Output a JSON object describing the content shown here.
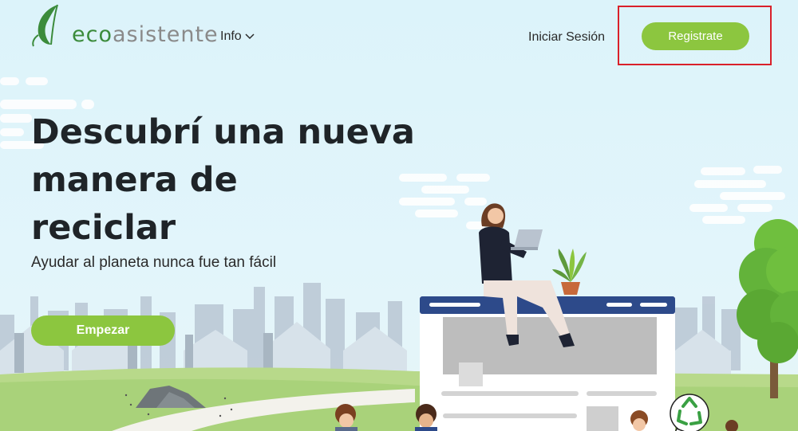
{
  "brand": {
    "logo_eco": "eco",
    "logo_rest": "asistente",
    "accent_color": "#8cc63f",
    "logo_green": "#3b8b3b",
    "highlight_color": "#d9202a"
  },
  "nav": {
    "info_label": "Info",
    "info_icon": "chevron-down-icon",
    "login_label": "Iniciar Sesión",
    "register_label": "Registrate"
  },
  "hero": {
    "title_lines": [
      "Descubrí una nueva",
      "manera de",
      "reciclar"
    ],
    "subtitle": "Ayudar al planeta nunca fue tan fácil",
    "cta_label": "Empezar"
  },
  "illustration": {
    "icons": [
      "leaf-icon",
      "recycle-icon",
      "laptop-icon",
      "plant-icon",
      "tree-icon",
      "rock-icon"
    ]
  }
}
